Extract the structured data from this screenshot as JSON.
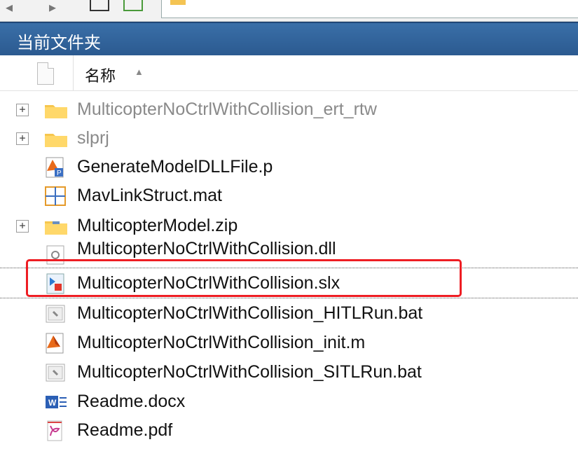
{
  "panel": {
    "title": "当前文件夹"
  },
  "columns": {
    "name_header": "名称"
  },
  "files": [
    {
      "name": "MulticopterNoCtrlWithCollision_ert_rtw",
      "icon": "folder-icon",
      "expandable": true
    },
    {
      "name": "slprj",
      "icon": "folder-icon",
      "expandable": true
    },
    {
      "name": "GenerateModelDLLFile.p",
      "icon": "matlab-p-file-icon",
      "expandable": false
    },
    {
      "name": "MavLinkStruct.mat",
      "icon": "mat-file-icon",
      "expandable": false
    },
    {
      "name": "MulticopterModel.zip",
      "icon": "zip-folder-icon",
      "expandable": true
    },
    {
      "name": "MulticopterNoCtrlWithCollision.dll",
      "icon": "dll-file-icon",
      "expandable": false
    },
    {
      "name": "MulticopterNoCtrlWithCollision.slx",
      "icon": "simulink-model-icon",
      "expandable": false,
      "highlighted": true
    },
    {
      "name": "MulticopterNoCtrlWithCollision_HITLRun.bat",
      "icon": "bat-file-icon",
      "expandable": false
    },
    {
      "name": "MulticopterNoCtrlWithCollision_init.m",
      "icon": "matlab-script-icon",
      "expandable": false
    },
    {
      "name": "MulticopterNoCtrlWithCollision_SITLRun.bat",
      "icon": "bat-file-icon",
      "expandable": false
    },
    {
      "name": "Readme.docx",
      "icon": "word-doc-icon",
      "expandable": false
    },
    {
      "name": "Readme.pdf",
      "icon": "pdf-file-icon",
      "expandable": false
    }
  ],
  "colors": {
    "titlebar": "#2f62a0",
    "highlight": "#ee1d23"
  }
}
